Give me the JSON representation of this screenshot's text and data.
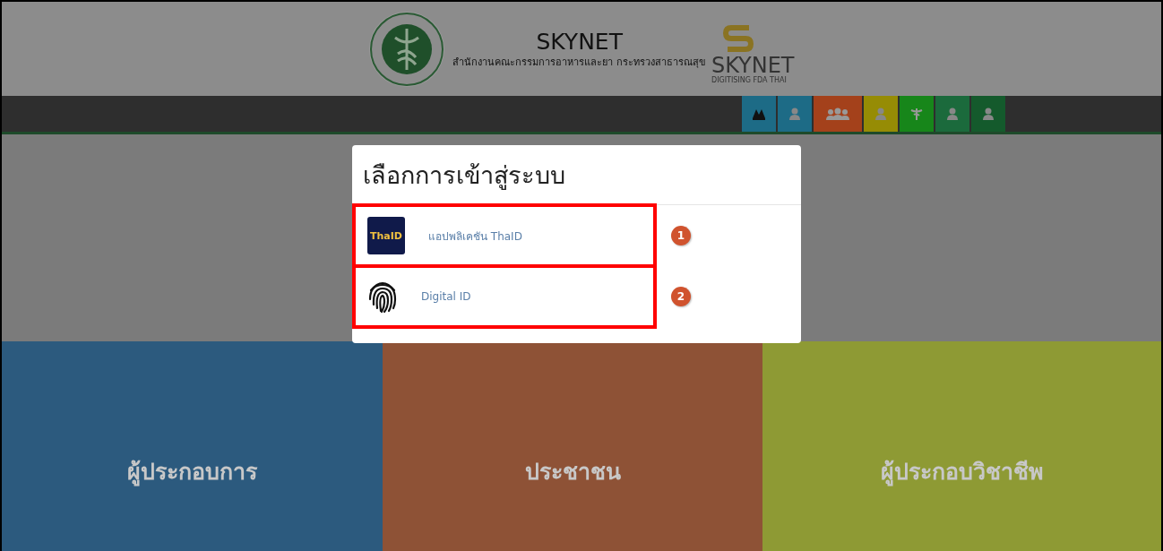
{
  "header": {
    "title": "SKYNET",
    "subtitle": "สำนักงานคณะกรรมการอาหารและยา กระทรวงสาธารณสุข",
    "logo_text": "SKYNET",
    "logo_tagline": "DIGITISING FDA THAI"
  },
  "nav_tiles": [
    {
      "kind": "mountain",
      "color": "#1d6b86"
    },
    {
      "kind": "person",
      "color": "#1d6b86"
    },
    {
      "kind": "group",
      "color": "#a4411b"
    },
    {
      "kind": "person",
      "color": "#968c05"
    },
    {
      "kind": "caduceus",
      "color": "#17861a"
    },
    {
      "kind": "person",
      "color": "#1b6a3c"
    },
    {
      "kind": "person",
      "color": "#145a2c"
    }
  ],
  "panels": [
    {
      "label": "ผู้ประกอบการ",
      "color": "#2c5a7e"
    },
    {
      "label": "ประชาชน",
      "color": "#8e5236"
    },
    {
      "label": "ผู้ประกอบวิชาชีพ",
      "color": "#8e9a34"
    }
  ],
  "modal": {
    "title": "เลือกการเข้าสู่ระบบ",
    "options": [
      {
        "kind": "thaid",
        "label": "แอปพลิเคชัน ThaID",
        "icon_text": "ThaID",
        "badge": "1"
      },
      {
        "kind": "fingerprint",
        "label": "Digital ID",
        "badge": "2"
      }
    ]
  }
}
